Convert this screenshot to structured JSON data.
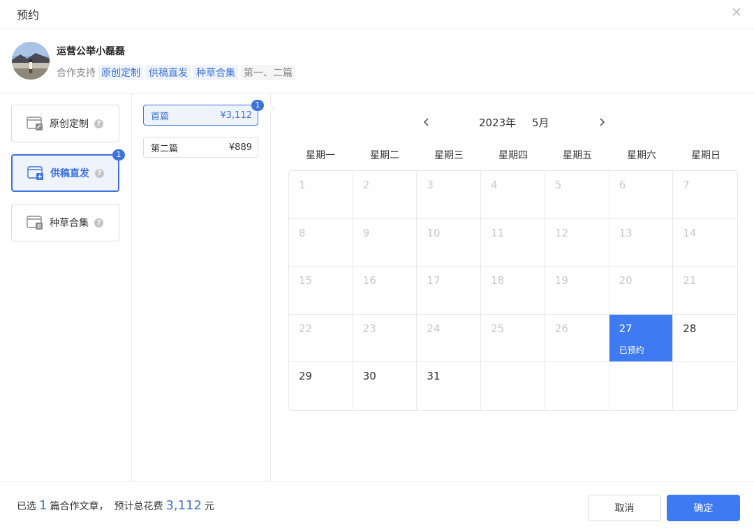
{
  "dialog": {
    "title": "预约"
  },
  "profile": {
    "name": "运营公举小磊磊",
    "support_label": "合作支持",
    "tags": [
      "原创定制",
      "供稿直发",
      "种草合集",
      "第一、二篇"
    ]
  },
  "types": [
    {
      "label": "原创定制",
      "icon": "document-edit-icon",
      "active": false,
      "badge": ""
    },
    {
      "label": "供稿直发",
      "icon": "document-plus-icon",
      "active": true,
      "badge": "1"
    },
    {
      "label": "种草合集",
      "icon": "document-list-icon",
      "active": false,
      "badge": ""
    }
  ],
  "articles": [
    {
      "label": "首篇",
      "price": "¥3,112",
      "active": true,
      "badge": "1"
    },
    {
      "label": "第二篇",
      "price": "¥889",
      "active": false,
      "badge": ""
    }
  ],
  "calendar": {
    "year": "2023年",
    "month": "5月",
    "weekdays": [
      "星期一",
      "星期二",
      "星期三",
      "星期四",
      "星期五",
      "星期六",
      "星期日"
    ],
    "days": [
      {
        "label": "1",
        "state": "disabled"
      },
      {
        "label": "2",
        "state": "disabled"
      },
      {
        "label": "3",
        "state": "disabled"
      },
      {
        "label": "4",
        "state": "disabled"
      },
      {
        "label": "5",
        "state": "disabled"
      },
      {
        "label": "6",
        "state": "disabled"
      },
      {
        "label": "7",
        "state": "disabled"
      },
      {
        "label": "8",
        "state": "disabled"
      },
      {
        "label": "9",
        "state": "disabled"
      },
      {
        "label": "10",
        "state": "disabled"
      },
      {
        "label": "11",
        "state": "disabled"
      },
      {
        "label": "12",
        "state": "disabled"
      },
      {
        "label": "13",
        "state": "disabled"
      },
      {
        "label": "14",
        "state": "disabled"
      },
      {
        "label": "15",
        "state": "disabled"
      },
      {
        "label": "16",
        "state": "disabled"
      },
      {
        "label": "17",
        "state": "disabled"
      },
      {
        "label": "18",
        "state": "disabled"
      },
      {
        "label": "19",
        "state": "disabled"
      },
      {
        "label": "20",
        "state": "disabled"
      },
      {
        "label": "21",
        "state": "disabled"
      },
      {
        "label": "22",
        "state": "disabled"
      },
      {
        "label": "23",
        "state": "disabled"
      },
      {
        "label": "24",
        "state": "disabled"
      },
      {
        "label": "25",
        "state": "disabled"
      },
      {
        "label": "26",
        "state": "disabled"
      },
      {
        "label": "27",
        "state": "booked",
        "note": "已预约"
      },
      {
        "label": "28",
        "state": "available"
      },
      {
        "label": "29",
        "state": "available"
      },
      {
        "label": "30",
        "state": "available"
      },
      {
        "label": "31",
        "state": "available"
      },
      {
        "label": "",
        "state": "empty"
      },
      {
        "label": "",
        "state": "empty"
      },
      {
        "label": "",
        "state": "empty"
      },
      {
        "label": "",
        "state": "empty"
      }
    ]
  },
  "footer": {
    "selected_prefix": "已选",
    "selected_count": "1",
    "selected_suffix": "篇合作文章，",
    "cost_prefix": "预计总花费",
    "cost_value": "3,112",
    "cost_unit": "元",
    "cancel_label": "取消",
    "confirm_label": "确定"
  },
  "colors": {
    "accent": "#3e7bf2",
    "accent_text": "#3e73d8",
    "accent_bg": "#eef3fc"
  }
}
